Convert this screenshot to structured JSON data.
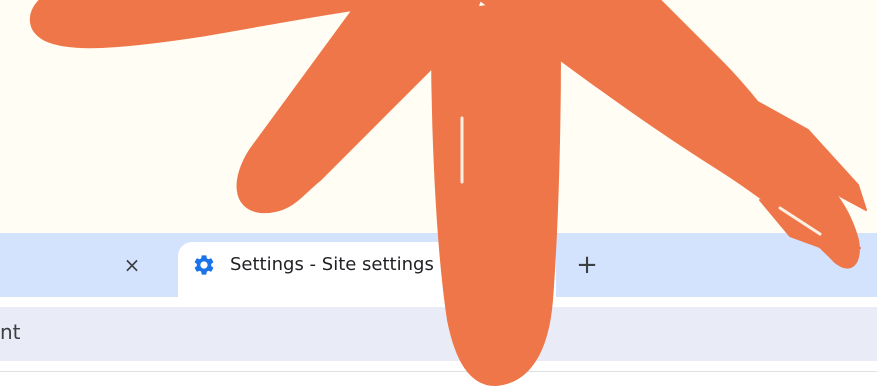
{
  "tabs": [
    {
      "label": "",
      "close_glyph": "×",
      "active": false
    },
    {
      "label": "Settings - Site settings",
      "icon": "gear-icon",
      "active": true
    }
  ],
  "new_tab_glyph": "+",
  "omnibox": {
    "text": "nt"
  },
  "colors": {
    "page_background": "#fffdf4",
    "tabstrip": "#d3e3fd",
    "active_tab": "#ffffff",
    "omnibox": "#e9ecf6",
    "gear_icon": "#1a73e8",
    "scribble": "#ee7649"
  }
}
